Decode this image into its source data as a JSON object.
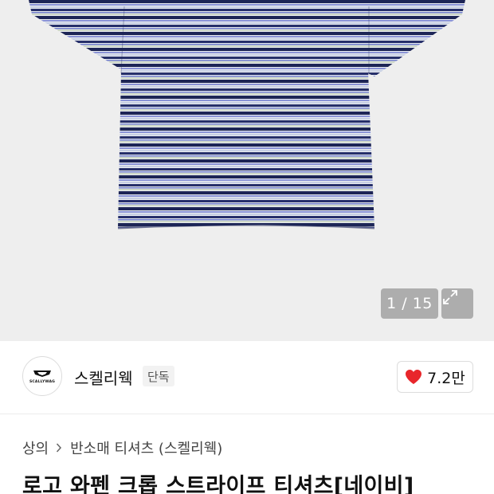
{
  "gallery": {
    "image_alt": "navy striped short-sleeve t-shirt",
    "counter": "1 / 15",
    "expand_icon": "expand-icon"
  },
  "brand": {
    "logo_text": "SCALLYWAG",
    "name": "스켈리웩",
    "badge": "단독",
    "like_count": "7.2만",
    "like_icon": "heart-icon",
    "like_color": "#e8262b"
  },
  "breadcrumb": {
    "items": [
      "상의",
      "반소매 티셔츠 (스켈리웩)"
    ],
    "separator_icon": "chevron-right-icon"
  },
  "product": {
    "title": "로고 와펜 크롭 스트라이프 티셔츠[네이비]"
  }
}
